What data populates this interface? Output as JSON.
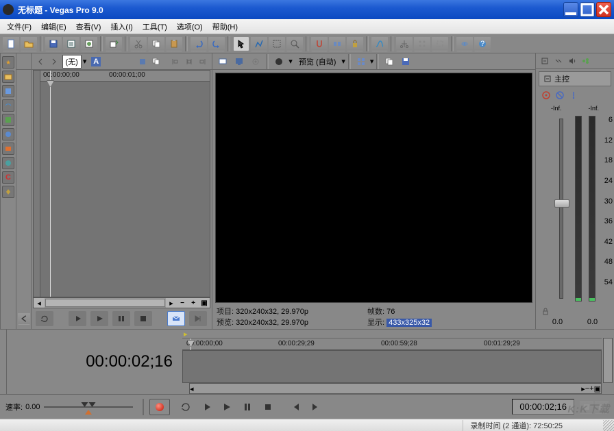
{
  "title": "无标题 - Vegas Pro 9.0",
  "menu": {
    "file": "文件(F)",
    "edit": "编辑(E)",
    "view": "查看(V)",
    "insert": "插入(I)",
    "tools": "工具(T)",
    "options": "选项(O)",
    "help": "帮助(H)"
  },
  "track": {
    "level_dropdown": "(无)",
    "ruler_tc": [
      "00:00:00;00",
      "00:00:01;00"
    ]
  },
  "preview": {
    "quality_label": "预览 (自动)",
    "info": {
      "project_label": "项目:",
      "project_val": "320x240x32, 29.970p",
      "preview_label": "预览:",
      "preview_val": "320x240x32, 29.970p",
      "frames_label": "帧数:",
      "frames_val": "76",
      "display_label": "显示:",
      "display_val": "433x325x32"
    }
  },
  "master": {
    "title": "主控",
    "inf_l": "-Inf.",
    "inf_r": "-Inf.",
    "scale": [
      "6",
      "12",
      "18",
      "24",
      "30",
      "36",
      "42",
      "48",
      "54"
    ],
    "db_l": "0.0",
    "db_r": "0.0"
  },
  "bottom": {
    "big_tc": "00:00:02;16",
    "ruler": [
      "00:00:00;00",
      "00:00:29;29",
      "00:00:59;28",
      "00:01:29;29"
    ]
  },
  "transport": {
    "rate_label": "速率:",
    "rate_value": "0.00",
    "tc": "00:00:02;16"
  },
  "watermark": "K:K下载",
  "status": {
    "rec_label": "录制时间 (2 通道):",
    "rec_val": "72:50:25"
  }
}
